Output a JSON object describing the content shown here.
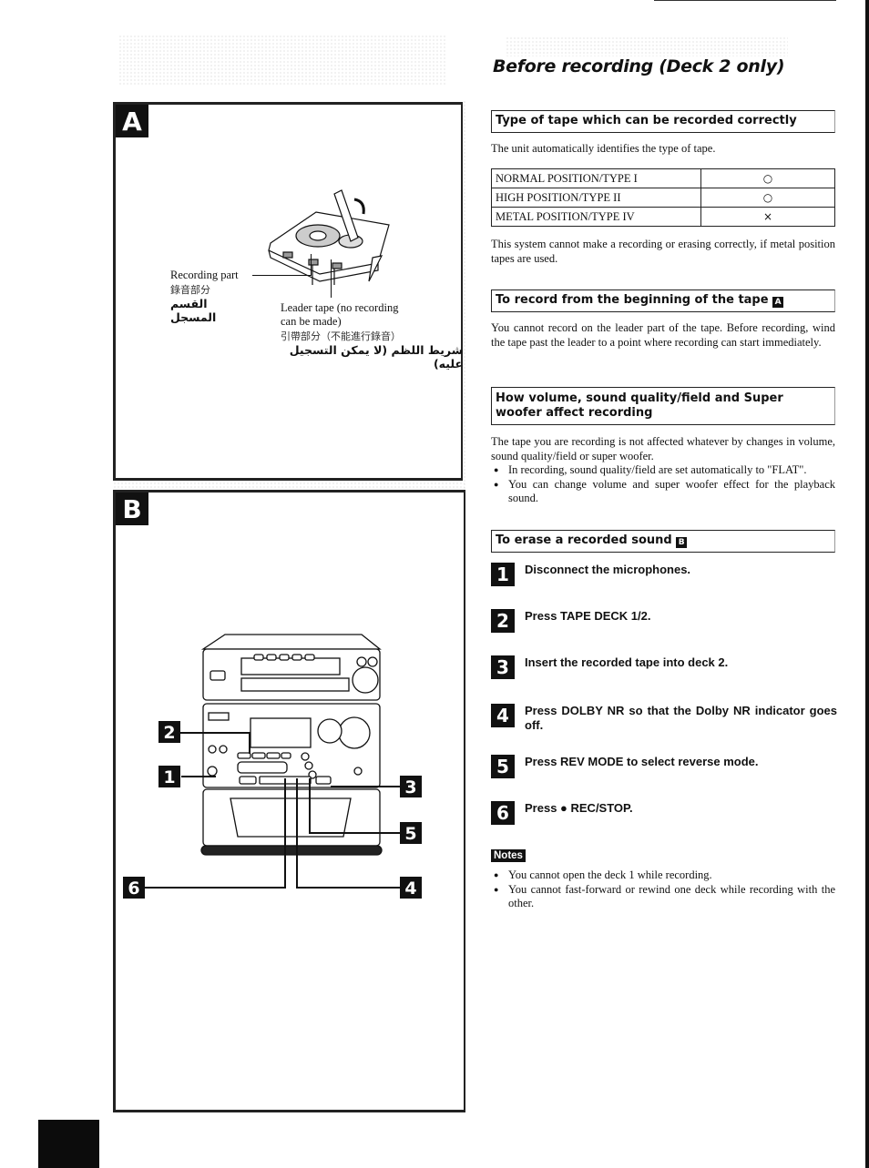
{
  "page": {
    "title": "Before recording (Deck 2 only)"
  },
  "figures": {
    "a": {
      "letter": "A",
      "recording_part": {
        "en": "Recording part",
        "zh": "錄音部分",
        "ar": "القسم المسجل"
      },
      "leader_tape": {
        "en_line1": "Leader tape (no recording",
        "en_line2": "can be made)",
        "zh": "引帶部分（不能進行錄音）",
        "ar": "شريط اللظم (لا يمكن التسجيل عليه)"
      }
    },
    "b": {
      "letter": "B",
      "callouts": [
        "1",
        "2",
        "3",
        "4",
        "5",
        "6"
      ]
    }
  },
  "sections": {
    "tape_type": {
      "heading": "Type of tape which can be recorded correctly",
      "intro": "The unit automatically identifies the type of tape.",
      "table": [
        {
          "type": "NORMAL POSITION/TYPE I",
          "mark": "○"
        },
        {
          "type": "HIGH POSITION/TYPE II",
          "mark": "○"
        },
        {
          "type": "METAL POSITION/TYPE IV",
          "mark": "×"
        }
      ],
      "note": "This system cannot make a recording or erasing correctly, if metal position tapes are used."
    },
    "record_beginning": {
      "heading": "To record from the beginning of the tape",
      "ref": "A",
      "body": "You cannot record on the leader part of the tape. Before recording, wind the tape past the leader to a point where recording can start immediately."
    },
    "volume_effect": {
      "heading_line1": "How volume, sound quality/field and Super",
      "heading_line2": "woofer affect recording",
      "body": "The tape you are recording is not affected whatever by changes in volume, sound quality/field or super woofer.",
      "bullets": [
        "In recording, sound quality/field are set automatically to \"FLAT\".",
        "You can change volume and super woofer effect for the playback sound."
      ]
    },
    "erase": {
      "heading": "To erase a recorded sound",
      "ref": "B",
      "steps": [
        {
          "num": "1",
          "text": "Disconnect the microphones."
        },
        {
          "num": "2",
          "text": "Press TAPE DECK 1/2."
        },
        {
          "num": "3",
          "text": "Insert the recorded tape into deck 2."
        },
        {
          "num": "4",
          "text": "Press DOLBY NR so that the Dolby NR indicator goes off."
        },
        {
          "num": "5",
          "text": "Press REV MODE to select reverse mode."
        },
        {
          "num": "6",
          "text": "Press ● REC/STOP."
        }
      ]
    },
    "notes": {
      "label": "Notes",
      "items": [
        "You cannot open the deck 1 while recording.",
        "You cannot fast-forward or rewind one deck while recording with the other."
      ]
    }
  }
}
